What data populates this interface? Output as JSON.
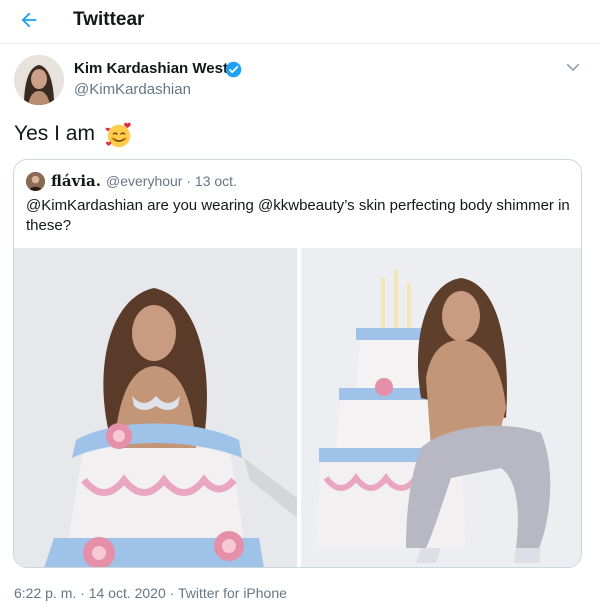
{
  "header": {
    "title": "Twittear"
  },
  "author": {
    "name": "Kim Kardashian West",
    "handle": "@KimKardashian"
  },
  "tweet": {
    "text": "Yes I am",
    "emoji": "smiling-face-with-hearts"
  },
  "quote": {
    "name": "flávia.",
    "handle_date": "@everyhour · 13 oct.",
    "text": "@KimKardashian are you wearing @kkwbeauty’s skin perfecting body shimmer in these?"
  },
  "meta": {
    "timestamp": "6:22 p. m. · 14 oct. 2020",
    "separator": " · ",
    "source": "Twitter for iPhone"
  },
  "colors": {
    "accent": "#1da1f2",
    "secondary_text": "#657786",
    "border": "#e6ecf0"
  }
}
